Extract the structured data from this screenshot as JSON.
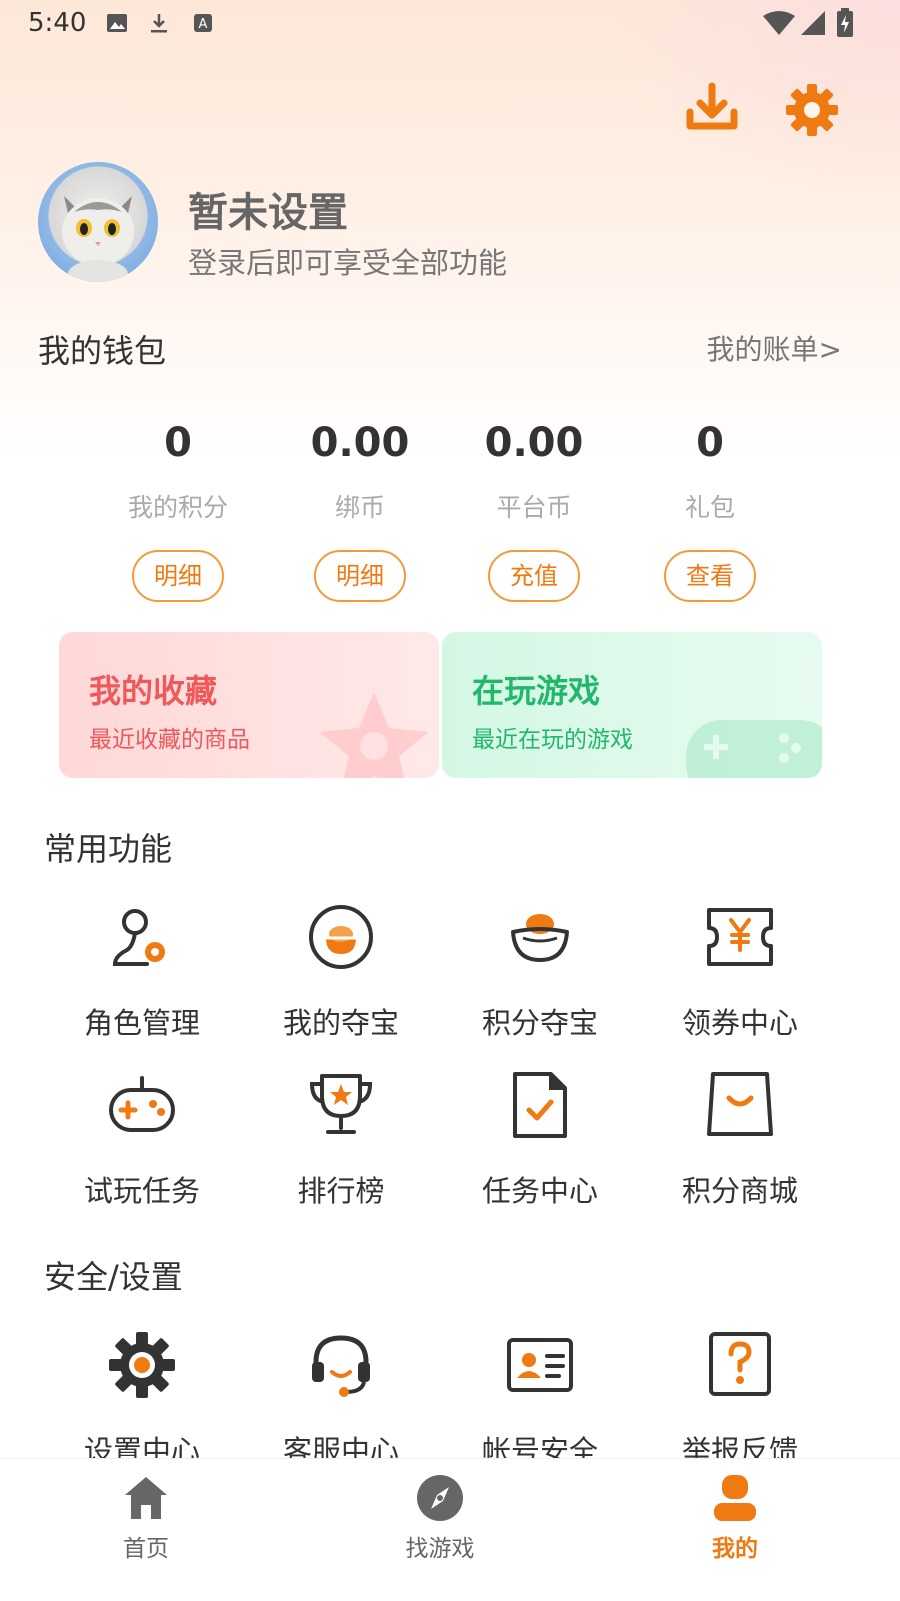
{
  "status_bar": {
    "time": "5:40"
  },
  "profile": {
    "name": "暂未设置",
    "subtitle": "登录后即可享受全部功能"
  },
  "wallet": {
    "title": "我的钱包",
    "bill_link": "我的账单>",
    "items": [
      {
        "value": "0",
        "label": "我的积分",
        "button": "明细"
      },
      {
        "value": "0.00",
        "label": "绑币",
        "button": "明细"
      },
      {
        "value": "0.00",
        "label": "平台币",
        "button": "充值"
      },
      {
        "value": "0",
        "label": "礼包",
        "button": "查看"
      }
    ]
  },
  "cards": {
    "favorites": {
      "title": "我的收藏",
      "subtitle": "最近收藏的商品"
    },
    "playing": {
      "title": "在玩游戏",
      "subtitle": "最近在玩的游戏"
    }
  },
  "common": {
    "title": "常用功能",
    "items": [
      {
        "label": "角色管理",
        "icon": "role-manage-icon"
      },
      {
        "label": "我的夺宝",
        "icon": "treasure-icon"
      },
      {
        "label": "积分夺宝",
        "icon": "points-treasure-icon"
      },
      {
        "label": "领券中心",
        "icon": "coupon-icon"
      },
      {
        "label": "试玩任务",
        "icon": "gamepad-icon"
      },
      {
        "label": "排行榜",
        "icon": "trophy-icon"
      },
      {
        "label": "任务中心",
        "icon": "task-icon"
      },
      {
        "label": "积分商城",
        "icon": "shop-bag-icon"
      }
    ]
  },
  "security": {
    "title": "安全/设置",
    "items": [
      {
        "label": "设置中心",
        "icon": "settings-icon"
      },
      {
        "label": "客服中心",
        "icon": "headset-icon"
      },
      {
        "label": "帐号安全",
        "icon": "id-card-icon"
      },
      {
        "label": "举报反馈",
        "icon": "report-icon"
      }
    ]
  },
  "nav": {
    "items": [
      {
        "label": "首页",
        "icon": "home-icon"
      },
      {
        "label": "找游戏",
        "icon": "compass-icon"
      },
      {
        "label": "我的",
        "icon": "profile-icon",
        "active": true
      }
    ]
  },
  "colors": {
    "accent": "#f07a12",
    "fav": "#f0585a",
    "playing": "#22b86c"
  }
}
